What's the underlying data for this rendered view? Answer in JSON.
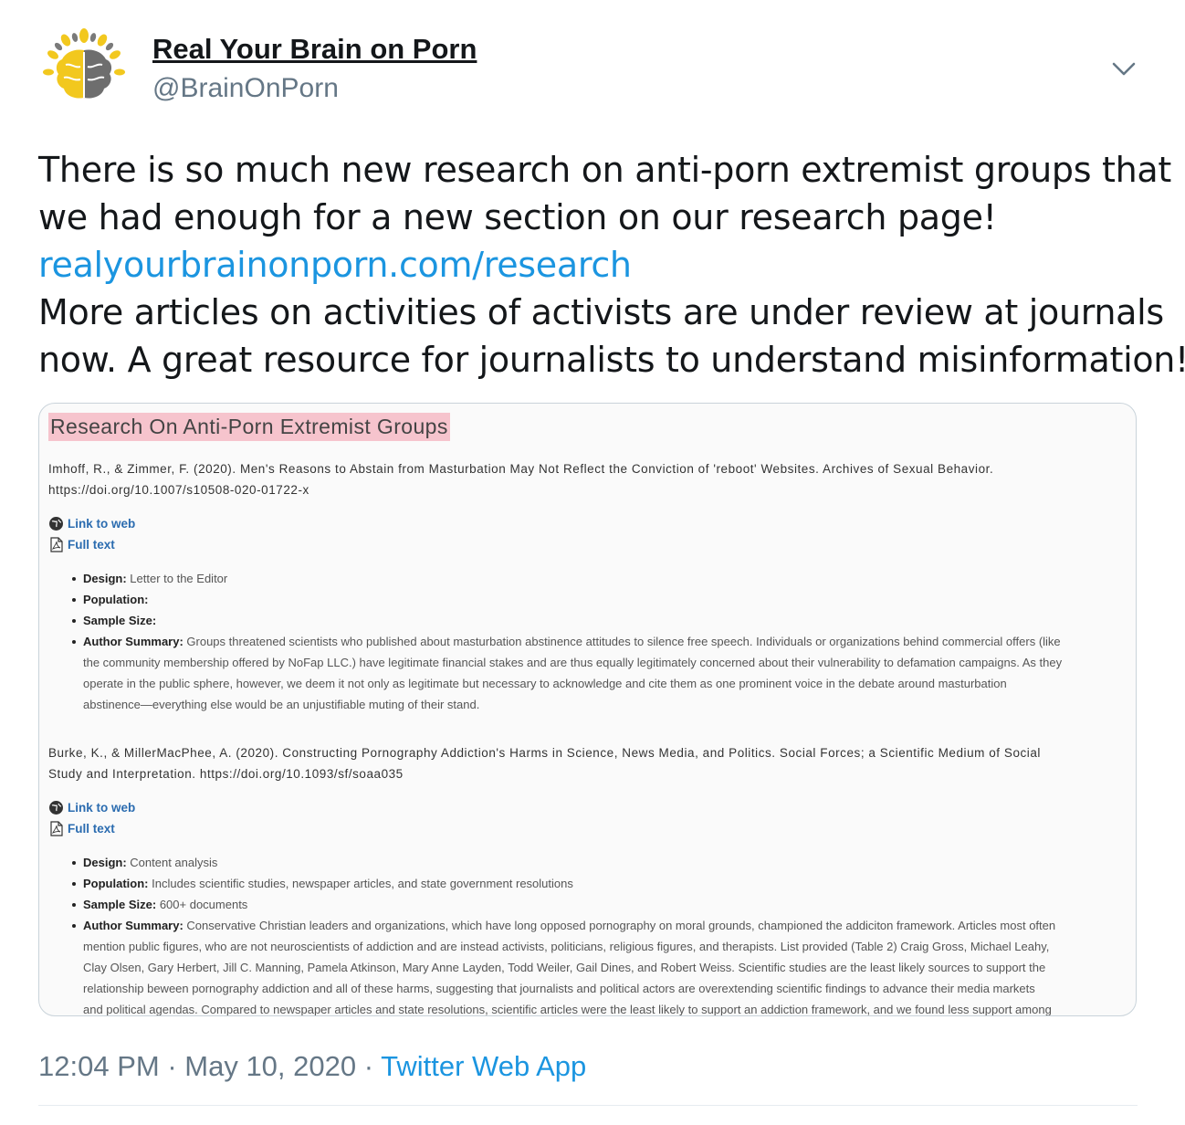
{
  "author": {
    "display_name": "Real Your Brain on Porn",
    "handle": "@BrainOnPorn",
    "avatar_icon": "brain-logo-icon"
  },
  "tweet": {
    "text_line_1": "There is so much new research on anti-porn extremist groups that",
    "text_line_2": "we had enough for a new section on our research page!",
    "link": "realyourbrainonporn.com/research",
    "text_line_4": "More articles on activities of activists are under review at journals",
    "text_line_5": "now. A great resource for journalists to understand misinformation!"
  },
  "card": {
    "heading": "Research On Anti-Porn Extremist Groups",
    "entries": [
      {
        "citation_line_1": "Imhoff, R., & Zimmer, F. (2020). Men's Reasons to Abstain from Masturbation May Not Reflect the Conviction of 'reboot' Websites. Archives of Sexual Behavior.",
        "citation_line_2": "https://doi.org/10.1007/s10508-020-01722-x",
        "link_web": "Link to web",
        "link_full": "Full text",
        "design_label": "Design:",
        "design_value": " Letter to the Editor",
        "population_label": "Population:",
        "population_value": "",
        "sample_label": "Sample Size:",
        "sample_value": "",
        "summary_label": "Author Summary:",
        "summary_lines": [
          " Groups threatened scientists who published about masturbation abstinence attitudes to silence free speech. Individuals or organizations behind commercial offers (like",
          "the community membership offered by NoFap LLC.) have legitimate financial stakes and are thus equally legitimately concerned about their vulnerability to defamation campaigns. As they",
          "operate in the public sphere, however, we deem it not only as legitimate but necessary to acknowledge and cite them as one prominent voice in the debate around masturbation",
          "abstinence—everything else would be an unjustifiable muting of their stand."
        ]
      },
      {
        "citation_line_1": "Burke, K., & MillerMacPhee, A. (2020). Constructing Pornography Addiction's Harms in Science, News Media, and Politics. Social Forces; a Scientific Medium of Social",
        "citation_line_2": "Study and Interpretation. https://doi.org/10.1093/sf/soaa035",
        "link_web": "Link to web",
        "link_full": "Full text",
        "design_label": "Design:",
        "design_value": " Content analysis",
        "population_label": "Population:",
        "population_value": " Includes scientific studies, newspaper articles, and state government resolutions",
        "sample_label": "Sample Size:",
        "sample_value": " 600+ documents",
        "summary_label": "Author Summary:",
        "summary_lines": [
          " Conservative Christian leaders and organizations, which have long opposed pornography on moral grounds, championed the addiciton framework. Articles most often",
          "mention public figures, who are not neuroscientists of addiction and are instead activists, politicians, religious figures, and therapists. List provided (Table 2) Craig Gross, Michael Leahy,",
          "Clay Olsen, Gary Herbert, Jill C. Manning, Pamela Atkinson, Mary Anne Layden, Todd Weiler, Gail Dines, and Robert Weiss. Scientific studies are the least likely sources to support the",
          "relationship beween pornography addiction and all of these harms, suggesting that journalists and political actors are overextending scientific findings to advance their media markets",
          "and political agendas. Compared to newspaper articles and state resolutions, scientific articles were the least likely to support an addiction framework, and we found less support among"
        ]
      }
    ]
  },
  "footer": {
    "time": "12:04 PM",
    "sep1": " · ",
    "date": "May 10, 2020",
    "sep2": " · ",
    "source": "Twitter Web App"
  },
  "colors": {
    "link": "#1b95e0",
    "heading_highlight": "#f6c4cd",
    "brain_yellow": "#f2c81e",
    "brain_gray": "#6e6e6e"
  }
}
